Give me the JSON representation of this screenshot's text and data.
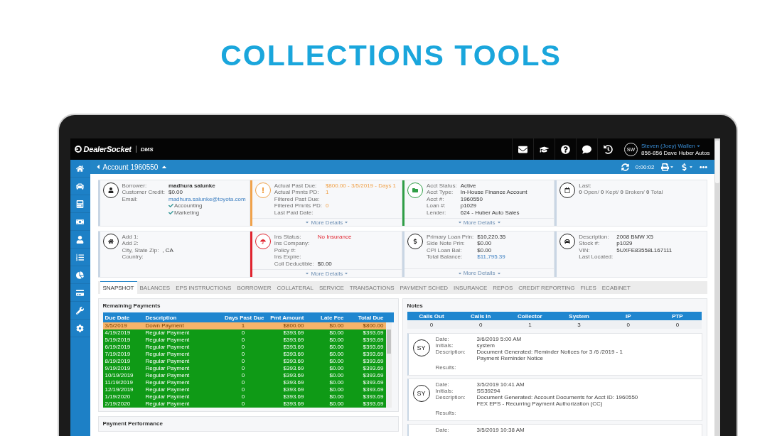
{
  "headline": "COLLECTIONS TOOLS",
  "topbar": {
    "brand": "DealerSocket",
    "product": "DMS",
    "user": {
      "initials": "SW",
      "name": "Steven (Joey) Wallen",
      "dealer": "856-856 Dave Huber Autos"
    }
  },
  "header": {
    "title": "Account 1960550",
    "timer": "0:00:02"
  },
  "cards": [
    {
      "color": "#c9d6e4",
      "alert": false,
      "fields": [
        {
          "label": "Borrower:",
          "value": "madhura salunke",
          "bold": true
        },
        {
          "label": "Customer Credit:",
          "value": "$0.00"
        },
        {
          "label": "Email:",
          "value": "madhura.salunke@toyota.com",
          "link": true
        }
      ],
      "checks": [
        {
          "label": "Accounting",
          "checked": true
        },
        {
          "label": "Marketing",
          "checked": true
        }
      ]
    },
    {
      "color": "#f0a24a",
      "alert": true,
      "fields": [
        {
          "label": "Actual Past Due:",
          "value": "$800.00 - 3/5/2019 - Days 1",
          "overdue": true
        },
        {
          "label": "Actual Pmnts PD:",
          "value": "1",
          "overdue": true
        },
        {
          "label": "Filtered Past Due:"
        },
        {
          "label": "Filtered Pmnts PD:",
          "value": "0",
          "overdue": true
        },
        {
          "label": "Last Paid Date:"
        }
      ],
      "more": "More Details"
    },
    {
      "color": "#2f9e46",
      "alert": true,
      "fields": [
        {
          "label": "Acct Status:",
          "value": "Active"
        },
        {
          "label": "Acct Type:",
          "value": "In-House Finance Account"
        },
        {
          "label": "Acct #:",
          "value": "1960550"
        },
        {
          "label": "Loan #:",
          "value": "p1029"
        },
        {
          "label": "Lender:",
          "value": "624 - Huber Auto Sales"
        }
      ],
      "more": "More Details"
    },
    {
      "color": "#c9d6e4",
      "alert": false,
      "fields": [
        {
          "label": "Last:"
        }
      ],
      "summary": "**0** Open/ **0** Kept/ **0** Broken/ **0** Total"
    },
    {
      "color": "#c9d6e4",
      "alert": false,
      "fields": [
        {
          "label": "Add 1:"
        },
        {
          "label": "Add 2:"
        },
        {
          "label": "City, State Zip:",
          "value": ", CA"
        },
        {
          "label": "Country:"
        }
      ]
    },
    {
      "color": "#e0242f",
      "alert": true,
      "fields": [
        {
          "label": "Ins Status:",
          "value": "No Insurance",
          "alert": true
        },
        {
          "label": "Ins Company:"
        },
        {
          "label": "Policy #:"
        },
        {
          "label": "Ins Expire:"
        },
        {
          "label": "Coll Deductible:",
          "value": "$0.00"
        }
      ],
      "more": "More Details"
    },
    {
      "color": "#c9d6e4",
      "alert": false,
      "fields": [
        {
          "label": "Primary Loan Prin:",
          "value": "$10,220.35"
        },
        {
          "label": "Side Note Prin:",
          "value": "$0.00"
        },
        {
          "label": "CPI Loan Bal:",
          "value": "$0.00"
        },
        {
          "label": "Total Balance:",
          "value": "$11,795.39",
          "link": true
        }
      ],
      "more": "More Details"
    },
    {
      "color": "#c9d6e4",
      "alert": false,
      "fields": [
        {
          "label": "Description:",
          "value": "2008 BMW X5"
        },
        {
          "label": "Stock #:",
          "value": "p1029"
        },
        {
          "label": "VIN:",
          "value": "5UXFE83558L167111"
        },
        {
          "label": "Last Located:"
        }
      ]
    }
  ],
  "tabs": [
    {
      "label": "SNAPSHOT",
      "selected": true
    },
    {
      "label": "BALANCES",
      "selected": false
    },
    {
      "label": "EPS INSTRUCTIONS",
      "selected": false
    },
    {
      "label": "BORROWER",
      "selected": false
    },
    {
      "label": "COLLATERAL",
      "selected": false
    },
    {
      "label": "SERVICE",
      "selected": false
    },
    {
      "label": "TRANSACTIONS",
      "selected": false
    },
    {
      "label": "PAYMENT SCHED",
      "selected": false
    },
    {
      "label": "INSURANCE",
      "selected": false
    },
    {
      "label": "REPOS",
      "selected": false
    },
    {
      "label": "CREDIT REPORTING",
      "selected": false
    },
    {
      "label": "FILES",
      "selected": false
    },
    {
      "label": "ECABINET",
      "selected": false
    }
  ],
  "payments": {
    "title": "Remaining Payments",
    "columns": [
      "Due Date",
      "Description",
      "Days Past Due",
      "Pmt Amount",
      "Late Fee",
      "Total Due"
    ],
    "rows": [
      {
        "past_due": true,
        "cells": [
          "3/5/2019",
          "Down Payment",
          "1",
          "$800.00",
          "$0.00",
          "$800.00"
        ]
      },
      {
        "past_due": false,
        "cells": [
          "4/19/2019",
          "Regular Payment",
          "0",
          "$393.69",
          "$0.00",
          "$393.69"
        ]
      },
      {
        "past_due": false,
        "cells": [
          "5/19/2019",
          "Regular Payment",
          "0",
          "$393.69",
          "$0.00",
          "$393.69"
        ]
      },
      {
        "past_due": false,
        "cells": [
          "6/19/2019",
          "Regular Payment",
          "0",
          "$393.69",
          "$0.00",
          "$393.69"
        ]
      },
      {
        "past_due": false,
        "cells": [
          "7/19/2019",
          "Regular Payment",
          "0",
          "$393.69",
          "$0.00",
          "$393.69"
        ]
      },
      {
        "past_due": false,
        "cells": [
          "8/19/2019",
          "Regular Payment",
          "0",
          "$393.69",
          "$0.00",
          "$393.69"
        ]
      },
      {
        "past_due": false,
        "cells": [
          "9/19/2019",
          "Regular Payment",
          "0",
          "$393.69",
          "$0.00",
          "$393.69"
        ]
      },
      {
        "past_due": false,
        "cells": [
          "10/19/2019",
          "Regular Payment",
          "0",
          "$393.69",
          "$0.00",
          "$393.69"
        ]
      },
      {
        "past_due": false,
        "cells": [
          "11/19/2019",
          "Regular Payment",
          "0",
          "$393.69",
          "$0.00",
          "$393.69"
        ]
      },
      {
        "past_due": false,
        "cells": [
          "12/19/2019",
          "Regular Payment",
          "0",
          "$393.69",
          "$0.00",
          "$393.69"
        ]
      },
      {
        "past_due": false,
        "cells": [
          "1/19/2020",
          "Regular Payment",
          "0",
          "$393.69",
          "$0.00",
          "$393.69"
        ]
      },
      {
        "past_due": false,
        "cells": [
          "2/19/2020",
          "Regular Payment",
          "0",
          "$393.69",
          "$0.00",
          "$393.69"
        ]
      }
    ]
  },
  "performance": {
    "title": "Payment Performance"
  },
  "notes": {
    "title": "Notes",
    "counts": {
      "columns": [
        "Calls Out",
        "Calls In",
        "Collector",
        "System",
        "IP",
        "PTP"
      ],
      "values": [
        "0",
        "0",
        "1",
        "3",
        "0",
        "0"
      ]
    },
    "entries": [
      {
        "avatar": "SY",
        "fields": [
          {
            "label": "Date:",
            "value": "3/6/2019 5:00 AM"
          },
          {
            "label": "Initials:",
            "value": "system"
          },
          {
            "label": "Description:",
            "value": "Document Generated: Reminder Notices for 3 /6 /2019 - 1\nPayment Reminder Notice"
          },
          {
            "label": "Results:"
          }
        ]
      },
      {
        "avatar": "SY",
        "fields": [
          {
            "label": "Date:",
            "value": "3/5/2019 10:41 AM"
          },
          {
            "label": "Initials:",
            "value": "SS39294"
          },
          {
            "label": "Description:",
            "value": "Document Generated: Account Documents for Acct ID: 1960550\nFEX EPS - Recurring Payment Authorization (CC)"
          },
          {
            "label": "Results:"
          }
        ]
      },
      {
        "fields": [
          {
            "label": "Date:",
            "value": "3/5/2019 10:38 AM"
          }
        ]
      }
    ]
  }
}
